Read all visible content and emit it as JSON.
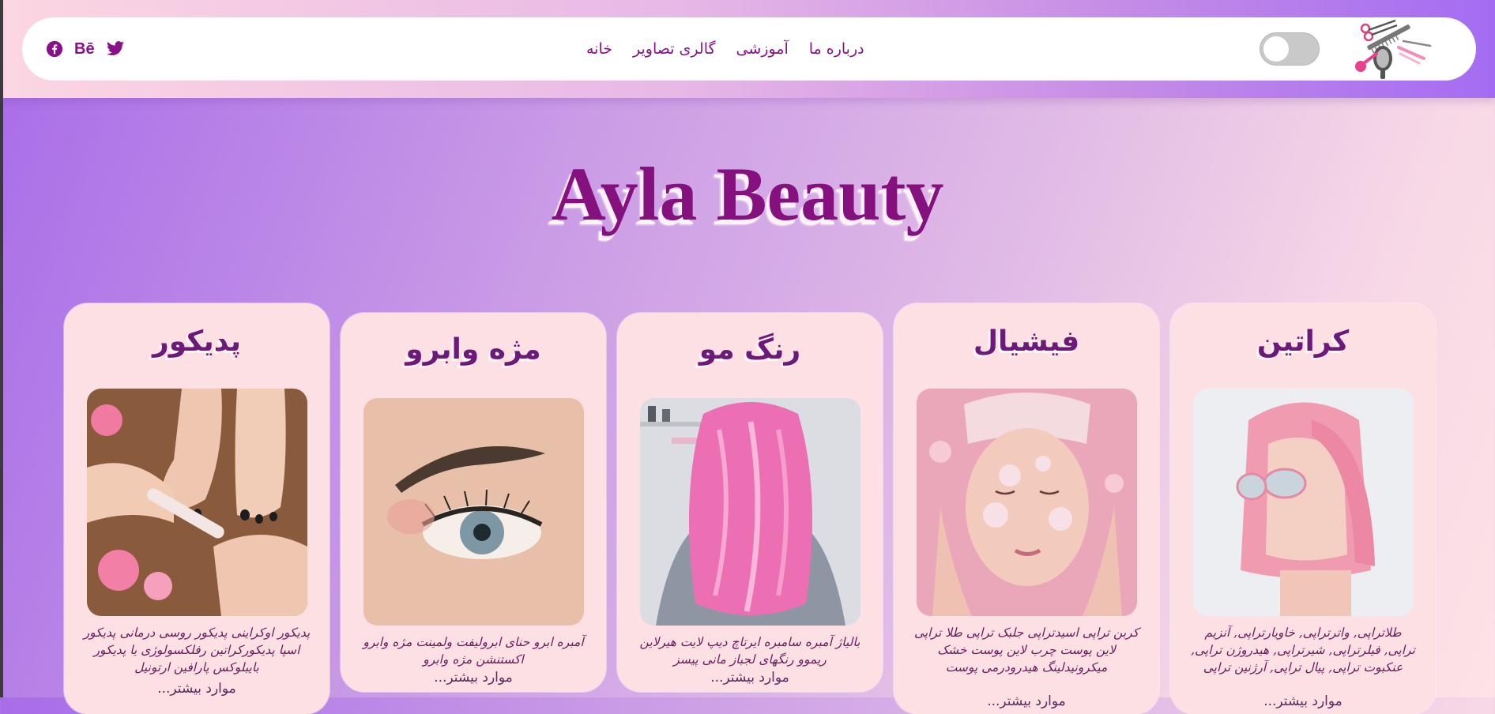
{
  "nav": {
    "links": [
      "خانه",
      "گالری تصاویر",
      "آموزشی",
      "درباره ما"
    ],
    "socials": [
      "twitter-icon",
      "behance-icon",
      "facebook-icon"
    ],
    "behance_label": "Bē",
    "theme_toggle": "off"
  },
  "hero": {
    "title": "Ayla Beauty"
  },
  "cards": [
    {
      "title": "کراتین",
      "description": "طلاتراپی, واترتراپی, خاویارتراپی, آنزیم تراپی, فیلرتراپی, شیرتراپی, هیدروژن تراپی, عنکبوت تراپی, پیال تراپی, آرژنین تراپی",
      "more": "موارد بیشتر..."
    },
    {
      "title": "فیشیال",
      "description": "کربن تراپی اسیدتراپی جلبک تراپی طلا تراپی لاین پوست چرب لاین پوست خشک میکرونیدلینگ هیدرودرمی پوست",
      "more": "موارد بیشتر..."
    },
    {
      "title": "رنگ مو",
      "description": "بالیاژ آمبره سامبره ایرتاچ دیپ لایت هیرلاین ریموو رنگهای لجباز مانی پیسز",
      "more": "موارد بیشتر..."
    },
    {
      "title": "مژه وابرو",
      "description": "آمبره ابرو حنای ابرولیفت ولمینت مژه وابرو اکستنشن مژه وابرو",
      "more": "موارد بیشتر..."
    },
    {
      "title": "پدیکور",
      "description": "پدیکور اوکراینی پدیکور روسی درمانی پدیکور اسپا پدیکورکراتین رفلکسولوژی یا پدیکور بایبلوکس پارافین ارتونیل",
      "more": "موارد بیشتر..."
    }
  ]
}
